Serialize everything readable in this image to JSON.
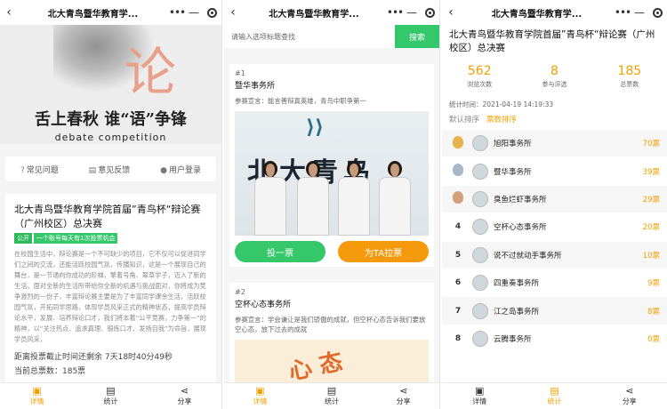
{
  "panel1": {
    "nav_title": "北大青鸟暨华教育学...",
    "banner": {
      "slogan": "舌上春秋 谁“语”争锋",
      "subtitle": "debate competition",
      "big_char": "论"
    },
    "quick_links": [
      {
        "icon": "question-icon",
        "label": "常见问题"
      },
      {
        "icon": "feedback-icon",
        "label": "意见反馈"
      },
      {
        "icon": "user-icon",
        "label": "用户登录"
      }
    ],
    "event": {
      "title": "北大青鸟暨华教育学院首届”青鸟杯“辩论赛（广州校区）总决赛",
      "tag_public": "公开",
      "tag_rule": "一个账号每天有1次投票机会",
      "description": "在校园生活中，辩论赛是一个不可缺少的项目，它不仅可以促进同学们之间的交流，还能活跃校园气氛，传播知识，这是一个展现自己的舞台，是一节通向你成功的阶梯，擎着号角、翠草学子，迈入了新的生活。面对全新的生活所带给你全新的机遇与挑战面对，你将成为竞争激烈的一份子，丰富辩论赛主要是为了丰富同学课余生活，活跃校园气氛，开拓同学思路，体现学员风采正式的精神状态，提高学员辩论水平，发展、培养辩论口才，我们将本着“公平竞赛，力争第一”的精神，以“关注热点、追求真理、锻炼口才、发扬自我”为命旨，展现学员风采，",
      "countdown": "距离投票截止时间还剩余 7天18时40分49秒",
      "total_votes": "当前总票数：185票"
    },
    "tabbar": [
      {
        "icon": "home-icon",
        "label": "详情"
      },
      {
        "icon": "stats-icon",
        "label": "统计"
      },
      {
        "icon": "share-icon",
        "label": "分享"
      }
    ]
  },
  "panel2": {
    "nav_title": "北大青鸟暨华教育学...",
    "search": {
      "placeholder": "请输入选项标题查找",
      "button": "搜索"
    },
    "entries": [
      {
        "no": "#1",
        "name": "暨华事务所",
        "declaration": "参赛宣言：能言善辩真英雄，青鸟中职争第一",
        "sign_text": "北大青鸟",
        "vote": "投一票",
        "canvass": "为TA拉票"
      },
      {
        "no": "#2",
        "name": "空杯心态事务所",
        "declaration": "参赛宣言：学会谦让是我们骄傲的成就，但空杯心态告诉我们要放空心态，放下过去的成就"
      }
    ],
    "tabbar": [
      {
        "icon": "home-icon",
        "label": "详情"
      },
      {
        "icon": "stats-icon",
        "label": "统计"
      },
      {
        "icon": "share-icon",
        "label": "分享"
      }
    ]
  },
  "panel3": {
    "nav_title": "北大青鸟暨华教育学...",
    "title": "北大青鸟暨华教育学院首届”青鸟杯“辩论赛（广州校区）总决赛",
    "stats": [
      {
        "value": "562",
        "label": "浏览次数"
      },
      {
        "value": "8",
        "label": "参与评选"
      },
      {
        "value": "185",
        "label": "总票数"
      }
    ],
    "stat_time": "统计时间：2021-04-19 14:19:33",
    "sort_default": "默认排序",
    "sort_votes": "票数排序",
    "ranking": [
      {
        "pos": "1",
        "name": "旭阳事务所",
        "votes": "70票",
        "medal": "#e8b24a"
      },
      {
        "pos": "2",
        "name": "暨华事务所",
        "votes": "39票",
        "medal": "#a9b8c8"
      },
      {
        "pos": "3",
        "name": "臭鱼烂虾事务所",
        "votes": "29票",
        "medal": "#d4a079"
      },
      {
        "pos": "4",
        "name": "空杯心态事务所",
        "votes": "20票"
      },
      {
        "pos": "5",
        "name": "说不过就动手事务所",
        "votes": "10票"
      },
      {
        "pos": "6",
        "name": "四重奏事务所",
        "votes": "9票"
      },
      {
        "pos": "7",
        "name": "江之岛事务所",
        "votes": "8票"
      },
      {
        "pos": "8",
        "name": "云腾事务所",
        "votes": "0票"
      }
    ],
    "tabbar": [
      {
        "icon": "home-icon",
        "label": "详情"
      },
      {
        "icon": "stats-icon",
        "label": "统计"
      },
      {
        "icon": "share-icon",
        "label": "分享"
      }
    ]
  },
  "colors": {
    "accent": "#f0a000",
    "green": "#36c76b",
    "orange": "#f59a0c"
  }
}
